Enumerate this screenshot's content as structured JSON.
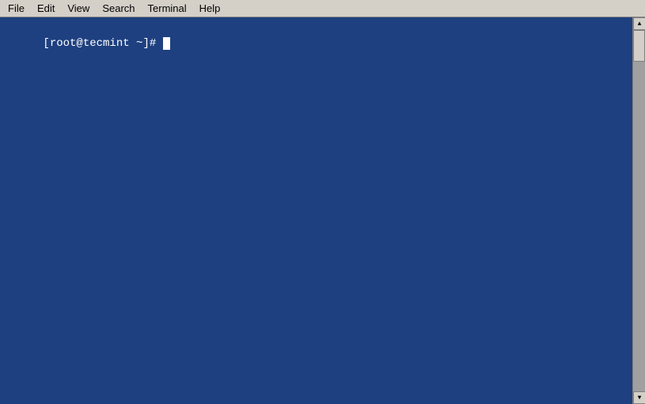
{
  "menubar": {
    "items": [
      {
        "id": "file",
        "label": "File"
      },
      {
        "id": "edit",
        "label": "Edit"
      },
      {
        "id": "view",
        "label": "View"
      },
      {
        "id": "search",
        "label": "Search"
      },
      {
        "id": "terminal",
        "label": "Terminal"
      },
      {
        "id": "help",
        "label": "Help"
      }
    ]
  },
  "terminal": {
    "prompt": "[root@tecmint ~]# "
  },
  "colors": {
    "menubar_bg": "#d4d0c8",
    "terminal_bg": "#1e4080",
    "terminal_text": "#ffffff"
  }
}
